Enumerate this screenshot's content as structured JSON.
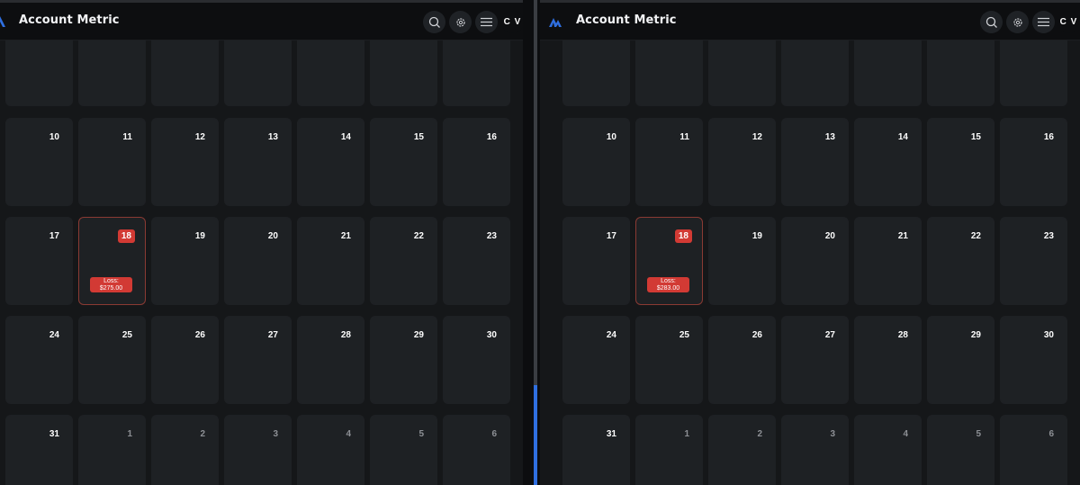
{
  "colors": {
    "accent": "#2f6fe0",
    "loss": "#d23a34",
    "today_border": "#8a3a33",
    "cell": "#1e2124"
  },
  "panes": [
    {
      "title": "Account Metric",
      "avatar": "C V",
      "icons": [
        "search-icon",
        "gear-icon",
        "menu-icon"
      ],
      "weeks": [
        {
          "days": [
            {
              "n": ""
            },
            {
              "n": ""
            },
            {
              "n": ""
            },
            {
              "n": ""
            },
            {
              "n": ""
            },
            {
              "n": ""
            },
            {
              "n": ""
            }
          ]
        },
        {
          "days": [
            {
              "n": "10"
            },
            {
              "n": "11"
            },
            {
              "n": "12"
            },
            {
              "n": "13"
            },
            {
              "n": "14"
            },
            {
              "n": "15"
            },
            {
              "n": "16"
            }
          ]
        },
        {
          "days": [
            {
              "n": "17"
            },
            {
              "n": "18",
              "today": true,
              "loss": "Loss:",
              "amount": "$275.00"
            },
            {
              "n": "19"
            },
            {
              "n": "20"
            },
            {
              "n": "21"
            },
            {
              "n": "22"
            },
            {
              "n": "23"
            }
          ]
        },
        {
          "days": [
            {
              "n": "24"
            },
            {
              "n": "25"
            },
            {
              "n": "26"
            },
            {
              "n": "27"
            },
            {
              "n": "28"
            },
            {
              "n": "29"
            },
            {
              "n": "30"
            }
          ]
        },
        {
          "days": [
            {
              "n": "31"
            },
            {
              "n": "1",
              "muted": true
            },
            {
              "n": "2",
              "muted": true
            },
            {
              "n": "3",
              "muted": true
            },
            {
              "n": "4",
              "muted": true
            },
            {
              "n": "5",
              "muted": true
            },
            {
              "n": "6",
              "muted": true
            }
          ]
        }
      ]
    },
    {
      "title": "Account Metric",
      "avatar": "C V",
      "icons": [
        "search-icon",
        "gear-icon",
        "menu-icon"
      ],
      "weeks": [
        {
          "days": [
            {
              "n": ""
            },
            {
              "n": ""
            },
            {
              "n": ""
            },
            {
              "n": ""
            },
            {
              "n": ""
            },
            {
              "n": ""
            },
            {
              "n": ""
            }
          ]
        },
        {
          "days": [
            {
              "n": "10"
            },
            {
              "n": "11"
            },
            {
              "n": "12"
            },
            {
              "n": "13"
            },
            {
              "n": "14"
            },
            {
              "n": "15"
            },
            {
              "n": "16"
            }
          ]
        },
        {
          "days": [
            {
              "n": "17"
            },
            {
              "n": "18",
              "today": true,
              "loss": "Loss:",
              "amount": "$283.00"
            },
            {
              "n": "19"
            },
            {
              "n": "20"
            },
            {
              "n": "21"
            },
            {
              "n": "22"
            },
            {
              "n": "23"
            }
          ]
        },
        {
          "days": [
            {
              "n": "24"
            },
            {
              "n": "25"
            },
            {
              "n": "26"
            },
            {
              "n": "27"
            },
            {
              "n": "28"
            },
            {
              "n": "29"
            },
            {
              "n": "30"
            }
          ]
        },
        {
          "days": [
            {
              "n": "31"
            },
            {
              "n": "1",
              "muted": true
            },
            {
              "n": "2",
              "muted": true
            },
            {
              "n": "3",
              "muted": true
            },
            {
              "n": "4",
              "muted": true
            },
            {
              "n": "5",
              "muted": true
            },
            {
              "n": "6",
              "muted": true
            }
          ]
        }
      ]
    }
  ]
}
